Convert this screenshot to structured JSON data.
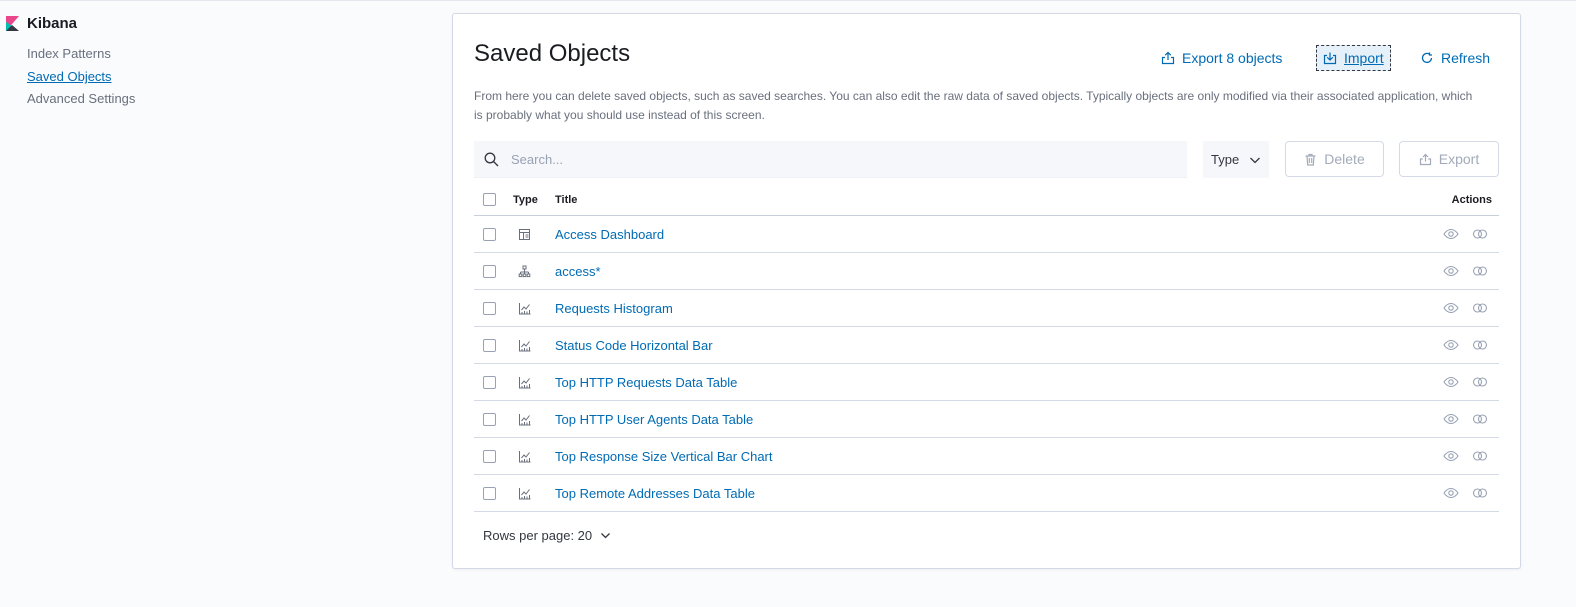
{
  "app": {
    "title": "Kibana"
  },
  "sidebar": {
    "items": [
      {
        "label": "Index Patterns",
        "active": false
      },
      {
        "label": "Saved Objects",
        "active": true
      },
      {
        "label": "Advanced Settings",
        "active": false
      }
    ]
  },
  "page": {
    "title": "Saved Objects",
    "description": "From here you can delete saved objects, such as saved searches. You can also edit the raw data of saved objects. Typically objects are only modified via their associated application, which is probably what you should use instead of this screen.",
    "header_actions": {
      "export_all": "Export 8 objects",
      "import": "Import",
      "refresh": "Refresh"
    }
  },
  "toolbar": {
    "search_placeholder": "Search...",
    "type_filter": "Type",
    "delete": "Delete",
    "export": "Export"
  },
  "table": {
    "headers": {
      "type": "Type",
      "title": "Title",
      "actions": "Actions"
    },
    "rows": [
      {
        "type": "dashboard",
        "title": "Access Dashboard"
      },
      {
        "type": "index-pattern",
        "title": "access*"
      },
      {
        "type": "visualization",
        "title": "Requests Histogram"
      },
      {
        "type": "visualization",
        "title": "Status Code Horizontal Bar"
      },
      {
        "type": "visualization",
        "title": "Top HTTP Requests Data Table"
      },
      {
        "type": "visualization",
        "title": "Top HTTP User Agents Data Table"
      },
      {
        "type": "visualization",
        "title": "Top Response Size Vertical Bar Chart"
      },
      {
        "type": "visualization",
        "title": "Top Remote Addresses Data Table"
      }
    ]
  },
  "pagination": {
    "rows_per_page": "Rows per page: 20"
  },
  "colors": {
    "accent": "#006bb4",
    "border": "#d3dae6",
    "text": "#343741",
    "muted": "#69707d"
  }
}
